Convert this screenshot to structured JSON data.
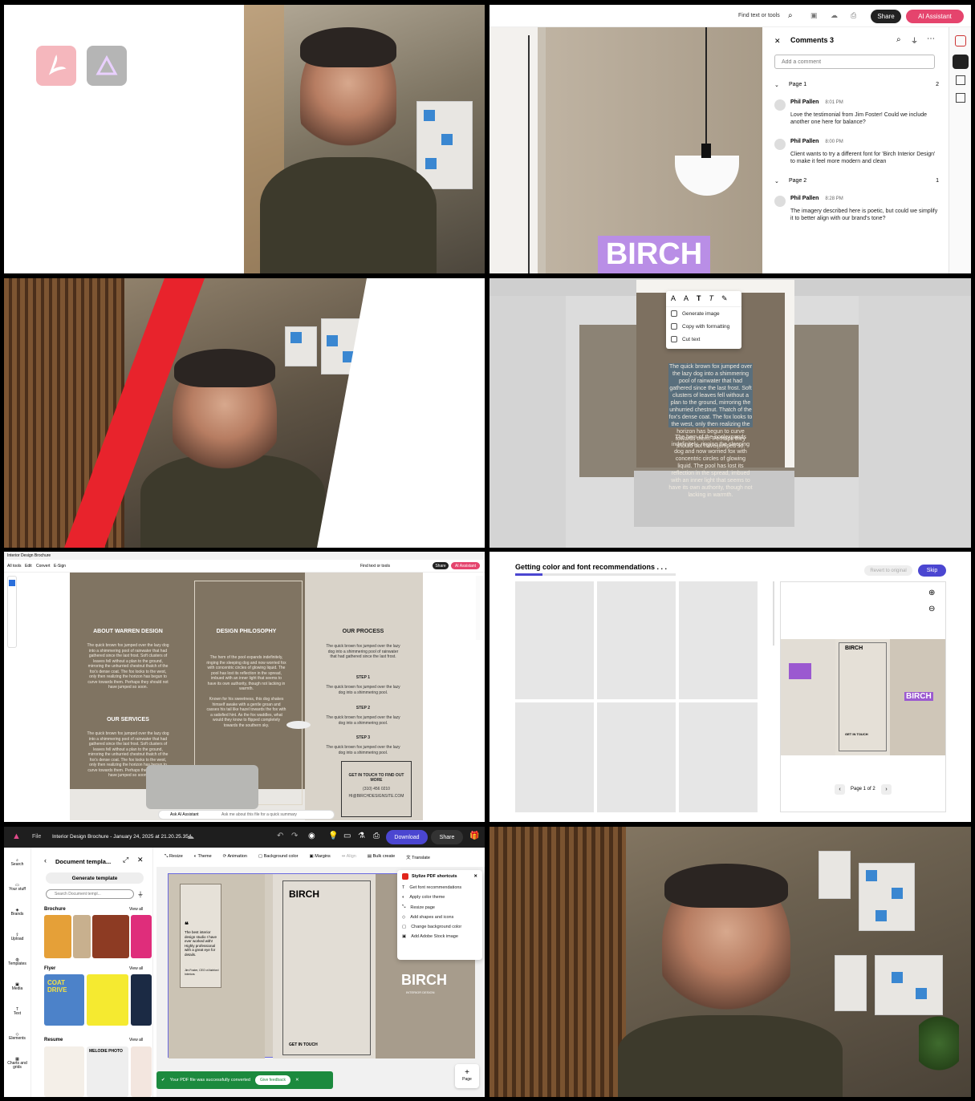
{
  "tile1": {
    "logos": [
      "acrobat-logo",
      "express-logo"
    ]
  },
  "tile2": {
    "toolbar": {
      "find_label": "Find text or tools",
      "share_label": "Share",
      "ai_label": "AI Assistant"
    },
    "comments": {
      "title": "Comments 3",
      "placeholder": "Add a comment",
      "groups": [
        {
          "page": "Page 1",
          "count": "2",
          "items": [
            {
              "author": "Phil Pallen",
              "time": "8:01 PM",
              "text": "Love the testimonial from Jim Foster! Could we include another one here for balance?"
            },
            {
              "author": "Phil Pallen",
              "time": "8:00 PM",
              "text": "Client wants to try a different font for 'Birch Interior Design' to make it feel more modern and clean"
            }
          ]
        },
        {
          "page": "Page 2",
          "count": "1",
          "items": [
            {
              "author": "Phil Pallen",
              "time": "8:28 PM",
              "text": "The imagery described here is poetic, but could we simplify it to better align with our brand's tone?"
            }
          ]
        }
      ]
    },
    "birch": "BIRCH"
  },
  "tile4": {
    "menu": [
      "Generate image",
      "Copy with formatting",
      "Cut text"
    ],
    "body1": "The quick brown fox jumped over the lazy dog into a shimmering pool of rainwater that had gathered since the last frost. Soft clusters of leaves fell without a plan to the ground, mirroring the unhurried chestnut. Thatch of the fox's dense coat. The fox looks to the west, only then realizing the horizon has begun to curve towards them. Perhaps they should not have jumped so.",
    "body2": "The hem of the poolexpands indefinitely, ringing the sleeping dog and now worried fox with concentric circles of glowing liquid. The pool has lost its reflection in the spread, imbued with an inner light that seems to have its own authority, though not lacking in warmth."
  },
  "tile5": {
    "tab": "Interior Design Brochure",
    "menu": [
      "All tools",
      "Edit",
      "Convert",
      "E-Sign"
    ],
    "find": "Find text or tools",
    "share": "Share",
    "ai": "AI Assistant",
    "col1_title": "ABOUT WARREN DESIGN",
    "col1_text": "The quick brown fox jumped over the lazy dog into a shimmering pool of rainwater that had gathered since the last frost. Soft clusters of leaves fell without a plan to the ground, mirroring the unhurried chestnut thatch of the fox's dense coat. The fox looks to the west, only then realizing the horizon has begun to curve towards them. Perhaps they should not have jumped so soon.",
    "col1b_title": "OUR SERVICES",
    "col1b_text": "The quick brown fox jumped over the lazy dog into a shimmering pool of rainwater that had gathered since the last frost. Soft clusters of leaves fell without a plan to the ground, mirroring the unhurried chestnut thatch of the fox's dense coat. The fox looks to the west, only then realizing the horizon has begun to curve towards them. Perhaps they should not have jumped so soon.",
    "col2_title": "DESIGN PHILOSOPHY",
    "col2_text": "The hem of the pool expands indefinitely, ringing the sleeping dog and now worried fox with concentric circles of glowing liquid. The pool has lost its reflection in the spread, imbued with an inner light that seems to have its own authority, though not lacking in warmth.",
    "col2b_text": "Known for his sweetness, this dog shakes himself awake with a gentle groan and casses his tail like hazel towards the fox with a satisfied hint. As the fox waddles, what would they know to flipped completely towards the southern sky.",
    "col3_title": "OUR PROCESS",
    "col3_text": "The quick brown fox jumped over the lazy dog into a shimmering pool of rainwater that had gathered since the last frost.",
    "steps": [
      {
        "label": "STEP 1",
        "text": "The quick brown fox jumped over the lazy dog into a shimmering pool."
      },
      {
        "label": "STEP 2",
        "text": "The quick brown fox jumped over the lazy dog into a shimmering pool."
      },
      {
        "label": "STEP 3",
        "text": "The quick brown fox jumped over the lazy dog into a shimmering pool."
      }
    ],
    "contact_title": "GET IN TOUCH TO FIND OUT MORE",
    "contact_phone": "(310) 456 0210",
    "contact_email": "HI@BIRCHDESIGNSITE.COM",
    "ask_ai": "Ask AI Assistant",
    "ask_placeholder": "Ask me about this file for a quick summary"
  },
  "tile6": {
    "status": "Getting color and font recommendations . . .",
    "revert": "Revert to original",
    "skip": "Skip",
    "preview_title": "BIRCH",
    "preview_birch": "BIRCH",
    "preview_touch": "GET IN TOUCH",
    "pager": "Page 1 of 2",
    "progress": 0.17
  },
  "tile7": {
    "file_menu": "File",
    "doc_title": "Interior Design Brochure - January 24, 2025 at 21.20.25.354",
    "download": "Download",
    "share": "Share",
    "panel_title": "Document templa...",
    "generate": "Generate template",
    "search_placeholder": "Search Document templ...",
    "sections": [
      {
        "name": "Brochure",
        "view": "View all"
      },
      {
        "name": "Flyer",
        "view": "View all"
      },
      {
        "name": "Resume",
        "view": "View all"
      }
    ],
    "flyer_texts": [
      "COAT DRIVE"
    ],
    "resume_texts": [
      "MELODIE PHOTO"
    ],
    "rail": [
      "Search",
      "Your stuff",
      "Brands",
      "Upload",
      "Templates",
      "Media",
      "Text",
      "Elements",
      "Charts and grids"
    ],
    "toolbar": [
      "Resize",
      "Theme",
      "Animation",
      "Background color",
      "Margins",
      "Align",
      "Bulk create",
      "Translate"
    ],
    "shortcuts_title": "Stylize PDF shortcuts",
    "shortcuts": [
      "Get font recommendations",
      "Apply color theme",
      "Resize page",
      "Add shapes and icons",
      "Change background color",
      "Add Adobe Stock image"
    ],
    "page_left_quote": "The best interior design studio I have ever worked with! Highly professional with a great eye for details.",
    "page_left_author": "Jim Foster, CEO of Ashford Interiors",
    "page_mid_title": "BIRCH",
    "page_mid_touch": "GET IN TOUCH",
    "page_right_birch": "BIRCH",
    "page_right_sub": "INTERIOR DESIGN",
    "toast": "Your PDF file was successfully converted",
    "feedback": "Give feedback",
    "add_page": "Page"
  }
}
